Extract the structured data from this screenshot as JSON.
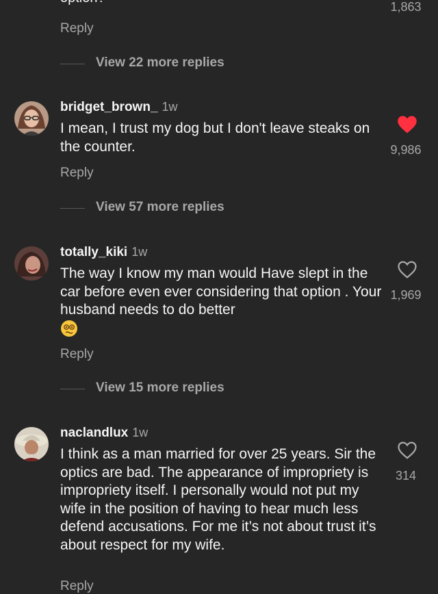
{
  "top": {
    "text_fragment": "option?",
    "like_count": "1,863",
    "reply_label": "Reply",
    "view_more": "View 22 more replies"
  },
  "comments": [
    {
      "username": "bridget_brown_",
      "time": "1w",
      "text": "I mean, I trust my dog but I don't leave steaks on the counter.",
      "like_count": "9,986",
      "liked": true,
      "reply_label": "Reply",
      "view_more": "View 57 more replies"
    },
    {
      "username": "totally_kiki",
      "time": "1w",
      "text": "The way I know my man would Have slept in the car before even ever considering that option . Your husband needs to do better",
      "like_count": "1,969",
      "liked": false,
      "emoji": "woozy-face-emoji",
      "reply_label": "Reply",
      "view_more": "View 15 more replies"
    },
    {
      "username": "naclandlux",
      "time": "1w",
      "text": "I think as a man married for over 25 years. Sir the optics are bad. The appearance of impropriety is impropriety itself. I personally would not put my wife in the position of having to hear much less defend accusations. For me it’s not about trust it’s about respect for my wife.",
      "like_count": "314",
      "liked": false,
      "reply_label": "Reply"
    }
  ],
  "colors": {
    "background": "#262626",
    "text": "#f5f5f5",
    "muted": "#a8a8a8",
    "heart_liked": "#ff3040"
  },
  "icons": {
    "like": "heart-icon",
    "liked": "heart-filled-icon"
  }
}
